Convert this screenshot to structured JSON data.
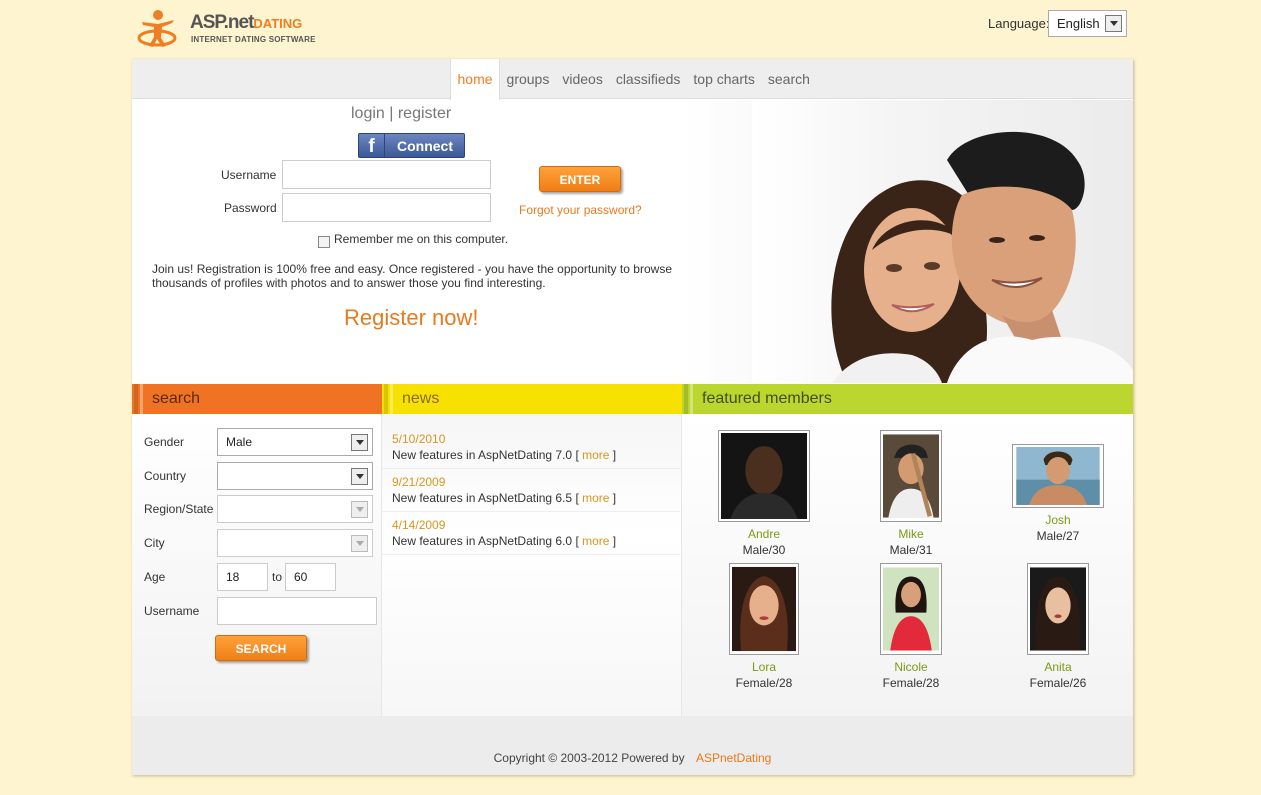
{
  "header": {
    "logo_text_main": "ASP.net",
    "logo_text_accent": "DATING",
    "logo_subtitle": "INTERNET DATING SOFTWARE",
    "language_label": "Language:",
    "language_value": "English"
  },
  "nav": {
    "items": [
      {
        "label": "home",
        "active": true
      },
      {
        "label": "groups"
      },
      {
        "label": "videos"
      },
      {
        "label": "classifieds"
      },
      {
        "label": "top charts"
      },
      {
        "label": "search"
      }
    ]
  },
  "login": {
    "title": "login | register",
    "fb_label": "Connect",
    "username_label": "Username",
    "password_label": "Password",
    "enter_label": "ENTER",
    "forgot_label": "Forgot your password?",
    "remember_label": "Remember me on this computer.",
    "join_text": "Join us! Registration is 100% free and easy. Once registered - you have the opportunity to browse thousands of profiles with photos and to answer those you find interesting.",
    "register_label": "Register now!"
  },
  "sections": {
    "search": "search",
    "news": "news",
    "featured": "featured members"
  },
  "search": {
    "gender_label": "Gender",
    "gender_value": "Male",
    "country_label": "Country",
    "region_label": "Region/State",
    "city_label": "City",
    "age_label": "Age",
    "age_from": "18",
    "age_to_label": "to",
    "age_to": "60",
    "username_label": "Username",
    "button_label": "SEARCH"
  },
  "news": {
    "items": [
      {
        "date": "5/10/2010",
        "title": "New features in AspNetDating 7.0",
        "more": "more"
      },
      {
        "date": "9/21/2009",
        "title": "New features in AspNetDating 6.5",
        "more": "more"
      },
      {
        "date": "4/14/2009",
        "title": "New features in AspNetDating 6.0",
        "more": "more"
      }
    ]
  },
  "featured": {
    "members": [
      {
        "name": "Andre",
        "info": "Male/30"
      },
      {
        "name": "Mike",
        "info": "Male/31"
      },
      {
        "name": "Josh",
        "info": "Male/27"
      },
      {
        "name": "Lora",
        "info": "Female/28"
      },
      {
        "name": "Nicole",
        "info": "Female/28"
      },
      {
        "name": "Anita",
        "info": "Female/26"
      }
    ]
  },
  "footer": {
    "copyright": "Copyright © 2003-2012 Powered by",
    "powered_link": "ASPnetDating"
  },
  "colors": {
    "accent_orange": "#ef7d22",
    "search_header": "#ef7323",
    "news_header": "#f7e100",
    "featured_header": "#bcd630",
    "page_bg": "#fef4cf"
  }
}
